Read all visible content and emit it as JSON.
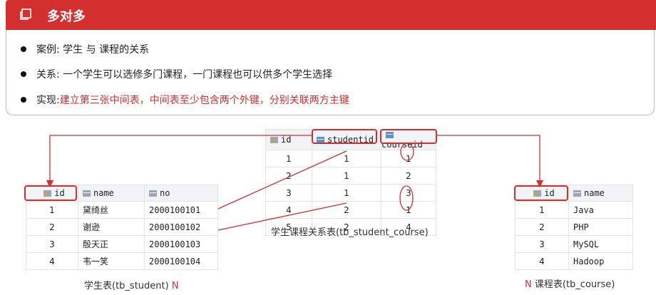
{
  "header": {
    "title": "多对多"
  },
  "bullets": {
    "b1": "案例: 学生 与 课程的关系",
    "b2": "关系: 一个学生可以选修多门课程，一门课程也可以供多个学生选择",
    "b3_prefix": "实现: ",
    "b3_red": "建立第三张中间表，中间表至少包含两个外键，分别关联两方主键"
  },
  "student_table": {
    "columns": [
      "id",
      "name",
      "no"
    ],
    "rows": [
      [
        "1",
        "黛绮丝",
        "2000100101"
      ],
      [
        "2",
        "谢逊",
        "2000100102"
      ],
      [
        "3",
        "殷天正",
        "2000100103"
      ],
      [
        "4",
        "韦一笑",
        "2000100104"
      ]
    ],
    "caption": "学生表(tb_student)",
    "caption_mark": "N"
  },
  "relation_table": {
    "columns": [
      "id",
      "studentid",
      "courseid"
    ],
    "rows": [
      [
        "1",
        "1",
        "1"
      ],
      [
        "2",
        "1",
        "2"
      ],
      [
        "3",
        "1",
        "3"
      ],
      [
        "4",
        "2",
        "1"
      ],
      [
        "5",
        "2",
        "4"
      ]
    ],
    "caption": "学生课程关系表(tb_student_course)"
  },
  "course_table": {
    "columns": [
      "id",
      "name"
    ],
    "rows": [
      [
        "1",
        "Java"
      ],
      [
        "2",
        "PHP"
      ],
      [
        "3",
        "MySQL"
      ],
      [
        "4",
        "Hadoop"
      ]
    ],
    "caption": "课程表(tb_course)",
    "caption_mark": "N"
  },
  "colors": {
    "accent": "#d32f2f"
  }
}
